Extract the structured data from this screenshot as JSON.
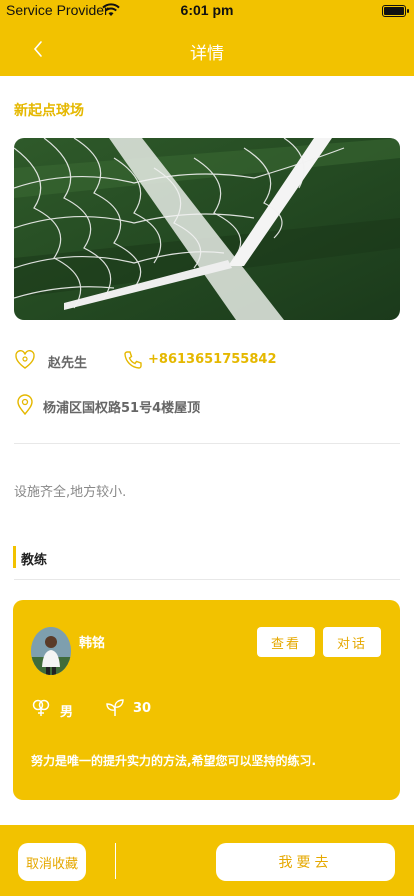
{
  "status_bar": {
    "carrier": "Service Provider",
    "time": "6:01 pm"
  },
  "nav": {
    "title": "详情"
  },
  "venue": {
    "name": "新起点球场"
  },
  "contact": {
    "name": "赵先生",
    "phone": "+8613651755842",
    "address": "杨浦区国权路51号4楼屋顶"
  },
  "description": "设施齐全,地方较小.",
  "section": {
    "coaches_title": "教练"
  },
  "coach": {
    "name": "韩铭",
    "gender": "男",
    "age": "30",
    "quote": "努力是唯一的提升实力的方法,希望您可以坚持的练习.",
    "view_label": "查看",
    "chat_label": "对话"
  },
  "bottom": {
    "cancel_label": "取消收藏",
    "go_label": "我要去"
  },
  "colors": {
    "accent": "#F2C200",
    "accent_text": "#E5B800"
  },
  "icons": [
    "wifi-icon",
    "battery-icon",
    "back-chevron-icon",
    "heart-person-icon",
    "phone-icon",
    "location-pin-icon",
    "gender-icon",
    "leaf-icon"
  ]
}
